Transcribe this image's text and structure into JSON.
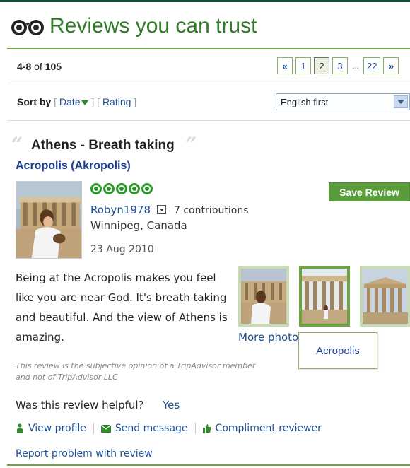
{
  "header": {
    "title": "Reviews you can trust",
    "logo_icon": "owl-eyes-icon"
  },
  "pagination": {
    "range": "4-8",
    "of_word": "of",
    "total": "105",
    "prev_label": "«",
    "next_label": "»",
    "pages": [
      "1",
      "2",
      "3"
    ],
    "current_page": "2",
    "ellipsis": "...",
    "last_page": "22"
  },
  "sort": {
    "label": "Sort by",
    "date_label": "Date",
    "rating_label": "Rating",
    "language_selected": "English first"
  },
  "review": {
    "title": "Athens - Breath taking",
    "attraction": "Acropolis (Akropolis)",
    "rating": 5,
    "save_label": "Save Review",
    "username": "Robyn1978",
    "contributions": "7 contributions",
    "location": "Winnipeg, Canada",
    "date": "23 Aug 2010",
    "body": "Being at the Acropolis makes you feel like you are near God. It's breath taking and beautiful. And the view of Athens is amazing.",
    "more_photos": "More photo",
    "photo_tooltip": "Acropolis",
    "disclaimer": "This review is the subjective opinion of a TripAdvisor member and not of TripAdvisor LLC",
    "helpful_question": "Was this review helpful?",
    "helpful_yes": "Yes",
    "actions": {
      "view_profile": "View profile",
      "send_message": "Send message",
      "compliment": "Compliment reviewer"
    },
    "report": "Report problem with review"
  },
  "colors": {
    "brand_green": "#2f7a27",
    "link_blue": "#1b4f95",
    "button_green": "#5a9c3a",
    "bubble_green": "#2c9a2a"
  }
}
